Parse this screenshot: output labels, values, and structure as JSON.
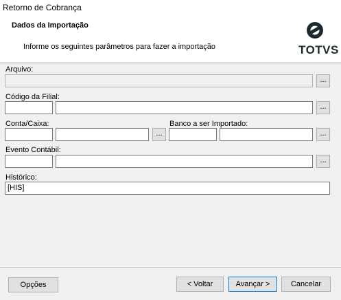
{
  "window": {
    "title": "Retorno de Cobrança"
  },
  "header": {
    "title": "Dados da Importação",
    "subtitle": "Informe os seguintes parâmetros para fazer a importação",
    "logo_text": "TOTVS"
  },
  "form": {
    "arquivo": {
      "label": "Arquivo:",
      "value": ""
    },
    "filial": {
      "label": "Código da Filial:",
      "code": "",
      "name": ""
    },
    "conta": {
      "label": "Conta/Caixa:",
      "code": "",
      "name": ""
    },
    "banco": {
      "label": "Banco a ser Importado:",
      "code": "",
      "name": ""
    },
    "evento": {
      "label": "Evento Contábil:",
      "code": "",
      "name": ""
    },
    "historico": {
      "label": "Histórico:",
      "value": "[HIS]"
    },
    "browse_label": "..."
  },
  "footer": {
    "options": "Opções",
    "back": "< Voltar",
    "next": "Avançar >",
    "cancel": "Cancelar"
  }
}
